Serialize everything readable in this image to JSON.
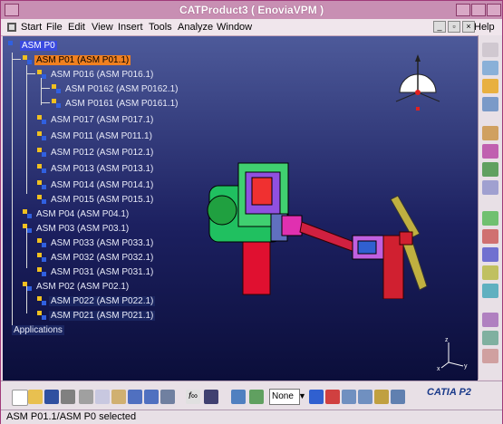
{
  "window": {
    "title": "CATProduct3 ( EnoviaVPM )"
  },
  "menu": {
    "items": [
      "Start",
      "File",
      "Edit",
      "View",
      "Insert",
      "Tools",
      "Analyze",
      "Window"
    ],
    "help": "Help"
  },
  "tree": {
    "nodes": [
      {
        "label": "ASM P0",
        "type": "root"
      },
      {
        "label": "ASM P01 (ASM P01.1)",
        "type": "selected"
      },
      {
        "label": "ASM P016 (ASM P016.1)"
      },
      {
        "label": "ASM P0162 (ASM P0162.1)"
      },
      {
        "label": "ASM P0161 (ASM P0161.1)"
      },
      {
        "label": "ASM P017 (ASM P017.1)"
      },
      {
        "label": "ASM P011 (ASM P011.1)"
      },
      {
        "label": "ASM P012 (ASM P012.1)"
      },
      {
        "label": "ASM P013 (ASM P013.1)"
      },
      {
        "label": "ASM P014 (ASM P014.1)"
      },
      {
        "label": "ASM P015 (ASM P015.1)"
      },
      {
        "label": "ASM P04 (ASM P04.1)"
      },
      {
        "label": "ASM P03 (ASM P03.1)"
      },
      {
        "label": "ASM P033 (ASM P033.1)"
      },
      {
        "label": "ASM P032 (ASM P032.1)"
      },
      {
        "label": "ASM P031 (ASM P031.1)"
      },
      {
        "label": "ASM P02 (ASM P02.1)"
      },
      {
        "label": "ASM P022 (ASM P022.1)"
      },
      {
        "label": "ASM P021 (ASM P021.1)"
      },
      {
        "label": "Applications",
        "type": "app"
      }
    ]
  },
  "toolbar": {
    "render_mode": "None",
    "logo": "CATIA P2"
  },
  "status": {
    "text": "ASM P01.1/ASM P0 selected"
  },
  "colors": {
    "title_bar": "#c88fb3",
    "selection": "#f08020",
    "viewport_top": "#4d5a9a",
    "viewport_bottom": "#0b0e3a"
  }
}
